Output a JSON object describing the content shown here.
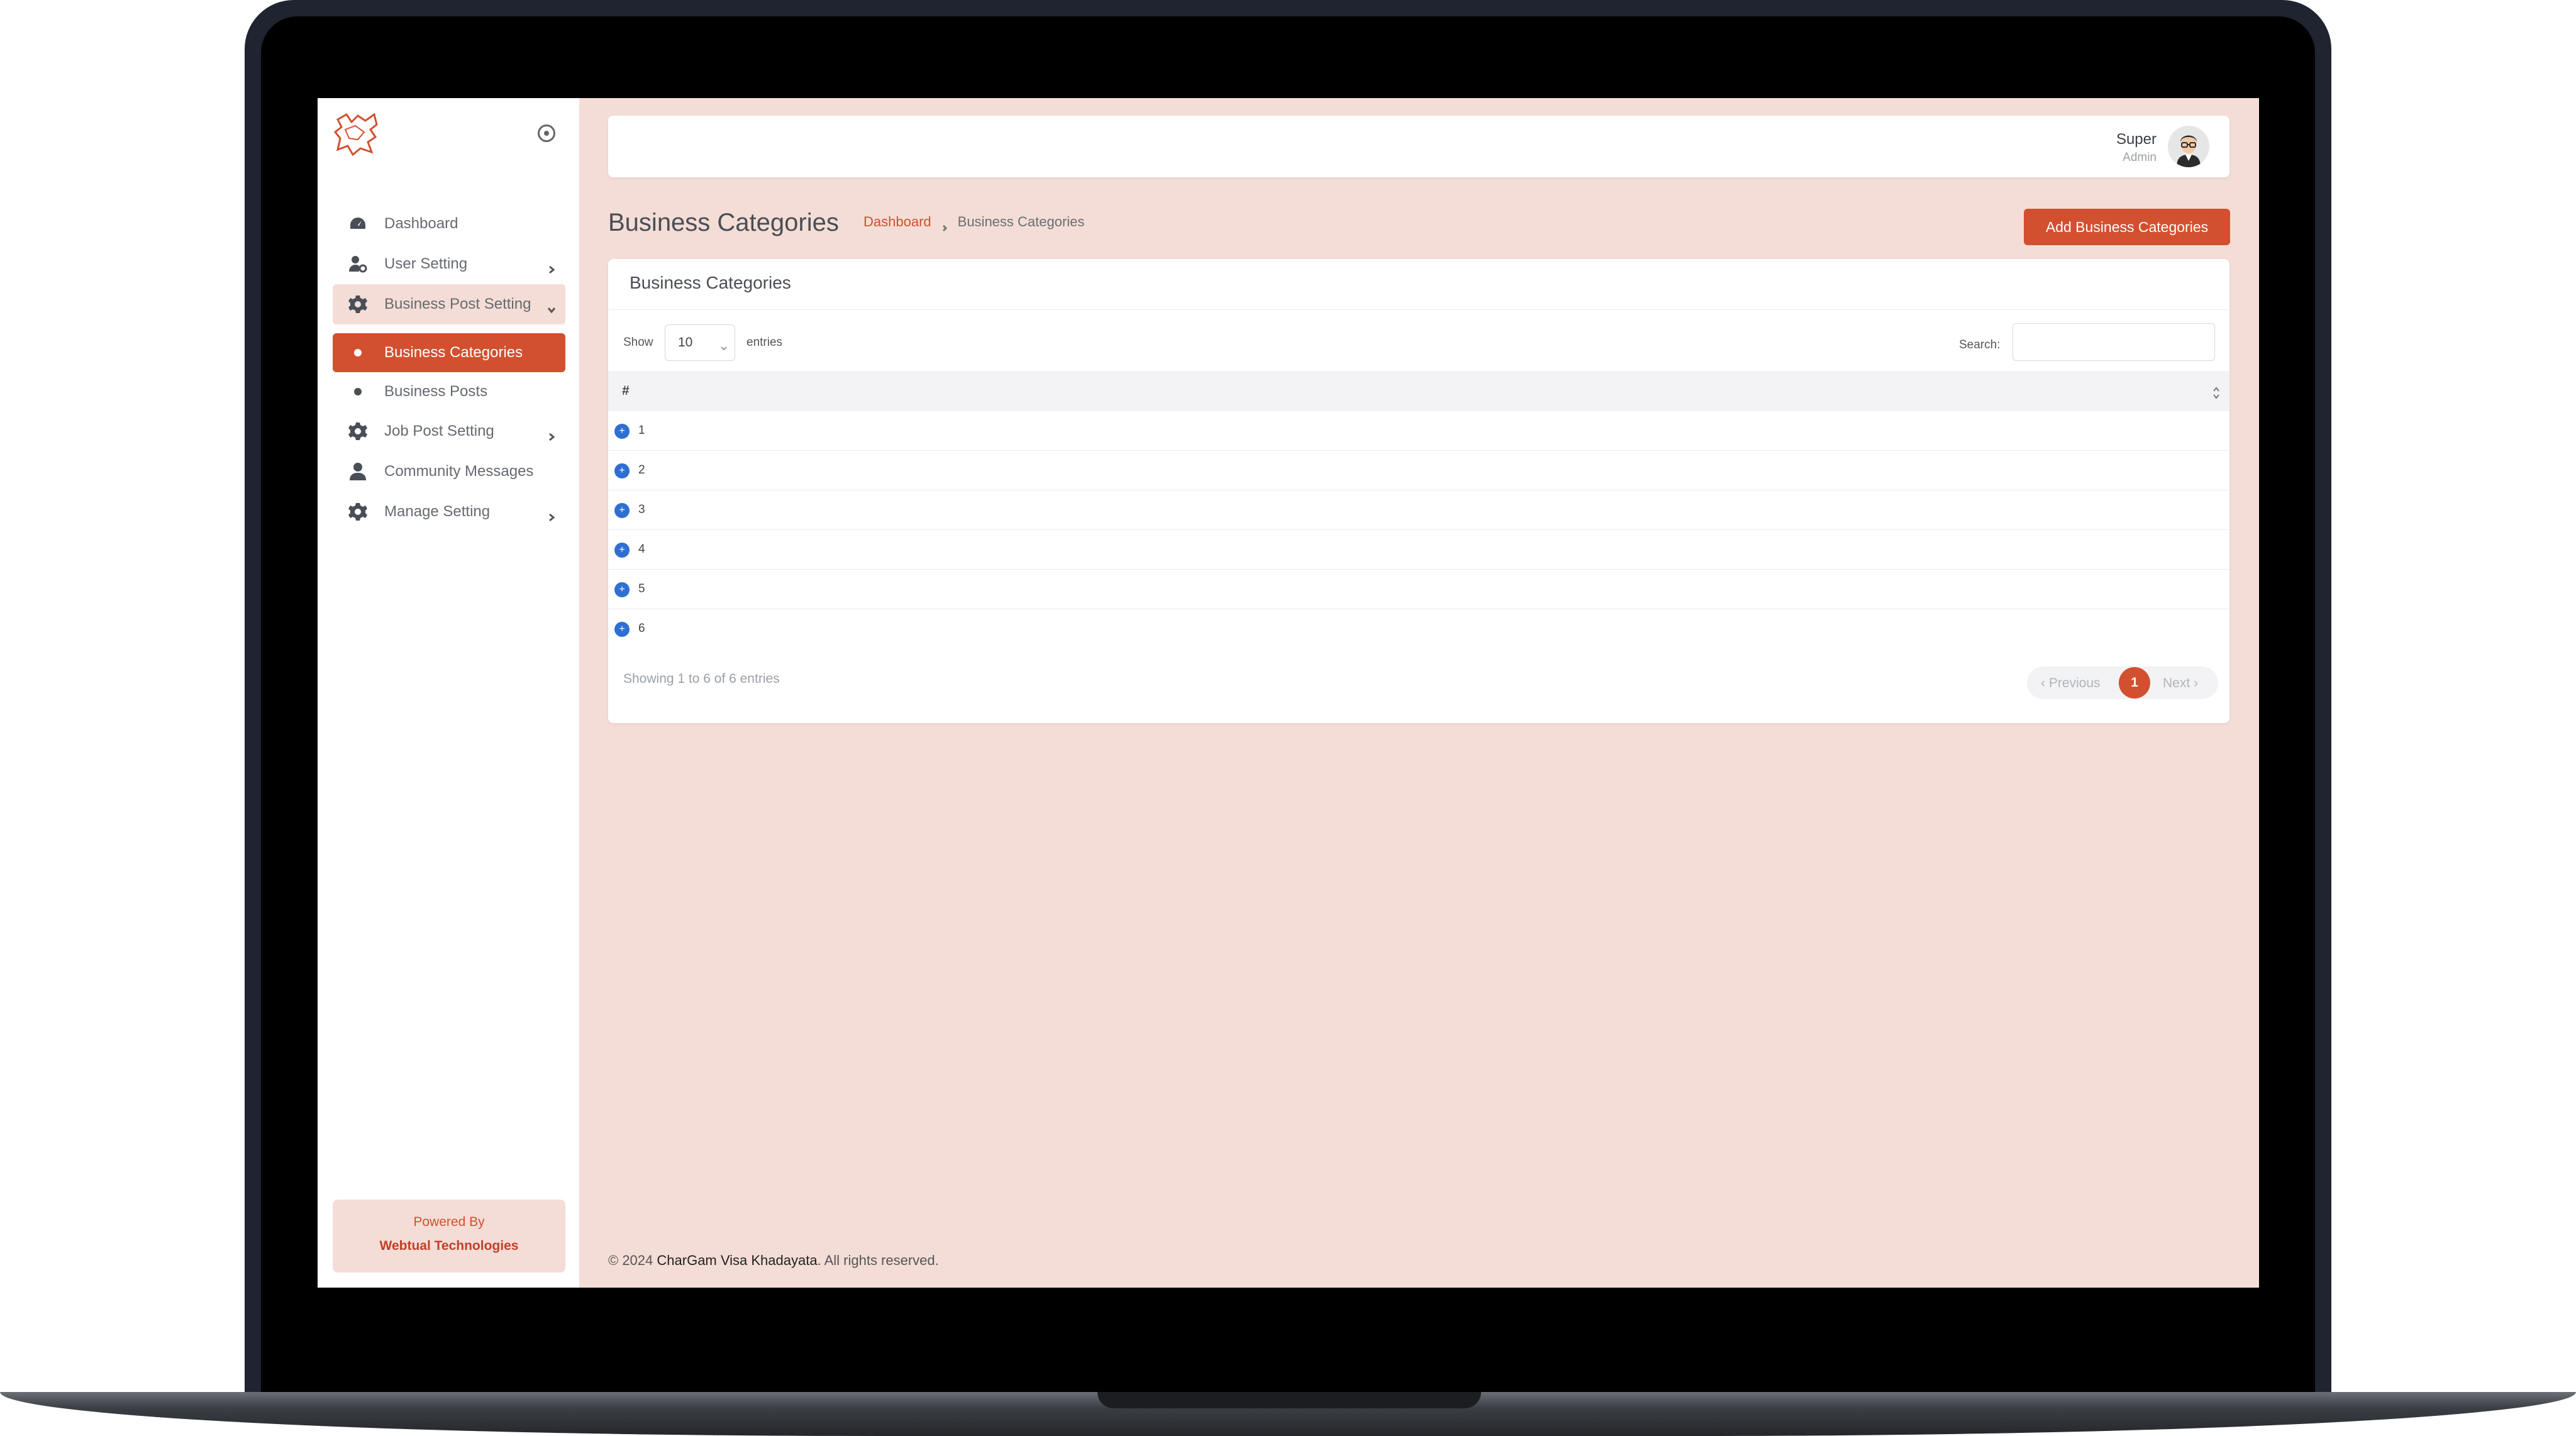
{
  "sidebar": {
    "toggle_icon": "circle-dot-icon",
    "items": [
      {
        "label": "Dashboard",
        "icon": "dashboard-icon"
      },
      {
        "label": "User Setting",
        "icon": "user-cog-icon"
      },
      {
        "label": "Business Post Setting",
        "icon": "gear-icon"
      },
      {
        "label": "Business Categories",
        "icon": "dot-icon"
      },
      {
        "label": "Business Posts",
        "icon": "dot-icon"
      },
      {
        "label": "Job Post Setting",
        "icon": "gear-icon"
      },
      {
        "label": "Community Messages",
        "icon": "user-icon"
      },
      {
        "label": "Manage Setting",
        "icon": "gear-icon"
      }
    ],
    "powered": {
      "line1": "Powered By",
      "line2": "Webtual Technologies"
    }
  },
  "topbar": {
    "user_name": "Super",
    "user_role": "Admin"
  },
  "page": {
    "title": "Business Categories",
    "breadcrumb": {
      "home": "Dashboard",
      "current": "Business Categories"
    },
    "add_button": "Add Business Categories"
  },
  "card": {
    "title": "Business Categories",
    "show_label": "Show",
    "page_length": "10",
    "entries_label": "entries",
    "search_label": "Search:",
    "column_header": "#",
    "rows": [
      "1",
      "2",
      "3",
      "4",
      "5",
      "6"
    ],
    "info": "Showing 1 to 6 of 6 entries",
    "pager": {
      "prev": "‹ Previous",
      "page": "1",
      "next": "Next ›"
    }
  },
  "footer": {
    "prefix": "© 2024",
    "brand": "CharGam Visa Khadayata",
    "suffix": ". All rights reserved."
  },
  "colors": {
    "accent": "#d2502f",
    "background": "#f4ddd6",
    "expand": "#2f6fd3"
  }
}
